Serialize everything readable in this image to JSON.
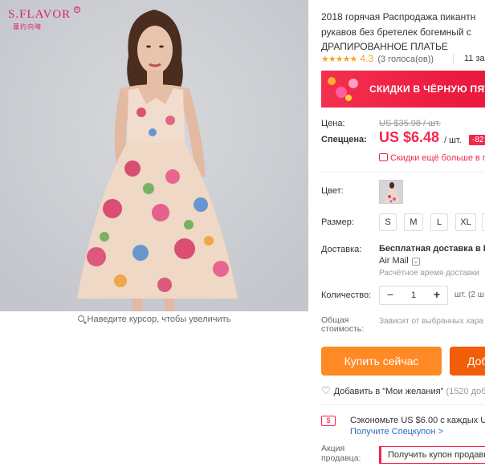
{
  "brand": {
    "name": "S.FLAVOR",
    "sub": "莆约向晴",
    "reg": "R"
  },
  "gallery": {
    "zoom_hint": "Наведите курсор, чтобы увеличить"
  },
  "product": {
    "title_lines": [
      "2018 горячая Распродажа пикантн",
      "рукавов без бретелек богемный с",
      "ДРАПИРОВАННОЕ ПЛАТЬЕ"
    ],
    "stars": "★★★★★",
    "rating": "4.3",
    "rating_count": "(3 голоса(ов))",
    "orders": "11 за"
  },
  "banner": {
    "text": "СКИДКИ В ЧЁРНУЮ ПЯТ"
  },
  "price": {
    "label": "Цена:",
    "old": "US $35.98 / шт.",
    "special_label": "Спеццена:",
    "new": "US $6.48",
    "unit": "/ шт.",
    "discount": "-82",
    "coupon_text": "Скидки ещё больше в пр"
  },
  "color": {
    "label": "Цвет:"
  },
  "size": {
    "label": "Размер:",
    "options": [
      "S",
      "M",
      "L",
      "XL",
      ""
    ]
  },
  "shipping": {
    "label": "Доставка:",
    "title": "Бесплатная доставка в Ru",
    "method": "Air Mail",
    "chevron": "⌄",
    "time": "Расчётное время доставки"
  },
  "quantity": {
    "label": "Количество:",
    "minus": "−",
    "value": "1",
    "plus": "+",
    "note": "шт. (2 ш"
  },
  "total": {
    "label": "Общая стоимость:",
    "value": "Зависит от выбранных хара"
  },
  "actions": {
    "buy": "Купить сейчас",
    "cart": "Доб"
  },
  "wishlist": {
    "heart": "♡",
    "text": "Добавить в \"Мои желания\"",
    "count": "(1520 доба"
  },
  "coupon": {
    "icon": "$",
    "save": "Сэкономьте US $6.00 с каждых US $",
    "link": "Получите Спецкупон >"
  },
  "promo": {
    "label": "Акция продавца:",
    "button": "Получить купон продавц"
  }
}
